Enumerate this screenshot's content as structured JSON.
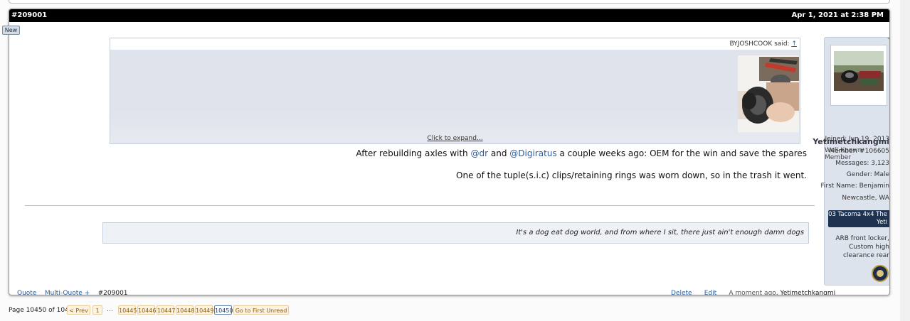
{
  "post": {
    "number": "#209001",
    "date": "Apr 1, 2021 at 2:38 PM",
    "new_badge": "New",
    "quote": {
      "author_said": "BYJOSHCOOK said:",
      "arrow": "↑",
      "expand": "Click to expand..."
    },
    "body": {
      "line1_prefix": "After rebuilding axles with ",
      "mention1": "@dr",
      "line1_mid": " and ",
      "mention2": "@Digiratus",
      "line1_suffix": " a couple weeks ago: OEM for the win and save the spares",
      "line2": "One of the tuple(s.i.c) clips/retaining rings was worn down, so in the trash it went."
    },
    "signature": "It's a dog eat dog world, and from where I sit, there just ain't enough damn dogs",
    "footer": {
      "author": "Yetimetchkangmi",
      "time": "A moment ago",
      "edit": "Edit",
      "delete": "Delete",
      "post_ref": "#209001",
      "multiquote": "Multi-Quote +",
      "quote": "Quote"
    }
  },
  "user": {
    "name": "Yetimetchkangmi",
    "title": "Well-Known Member",
    "joined": "Joined: Jun 19, 2013",
    "member": "Member: #106605",
    "messages": "Messages: 3,123",
    "gender": "Gender: Male",
    "first_name": "First Name: Benjamin",
    "location": "Newcastle, WA",
    "vehicle_button": "03 Tacoma 4x4 The Yeti",
    "mods_line1": "ARB front locker,",
    "mods_line2": "Custom high",
    "mods_line3": "clearance rear"
  },
  "pagination": {
    "label": "Page 10450 of 10450",
    "prev": "< Prev",
    "first": "1",
    "ellipsis": "…",
    "pages": [
      "10445",
      "10446",
      "10447",
      "10448",
      "10449",
      "10450"
    ],
    "goto": "Go to First Unread"
  },
  "colors": {
    "header_bg": "#000000",
    "link": "#2b5c9c",
    "vehicle_button_bg": "#1d3350"
  }
}
